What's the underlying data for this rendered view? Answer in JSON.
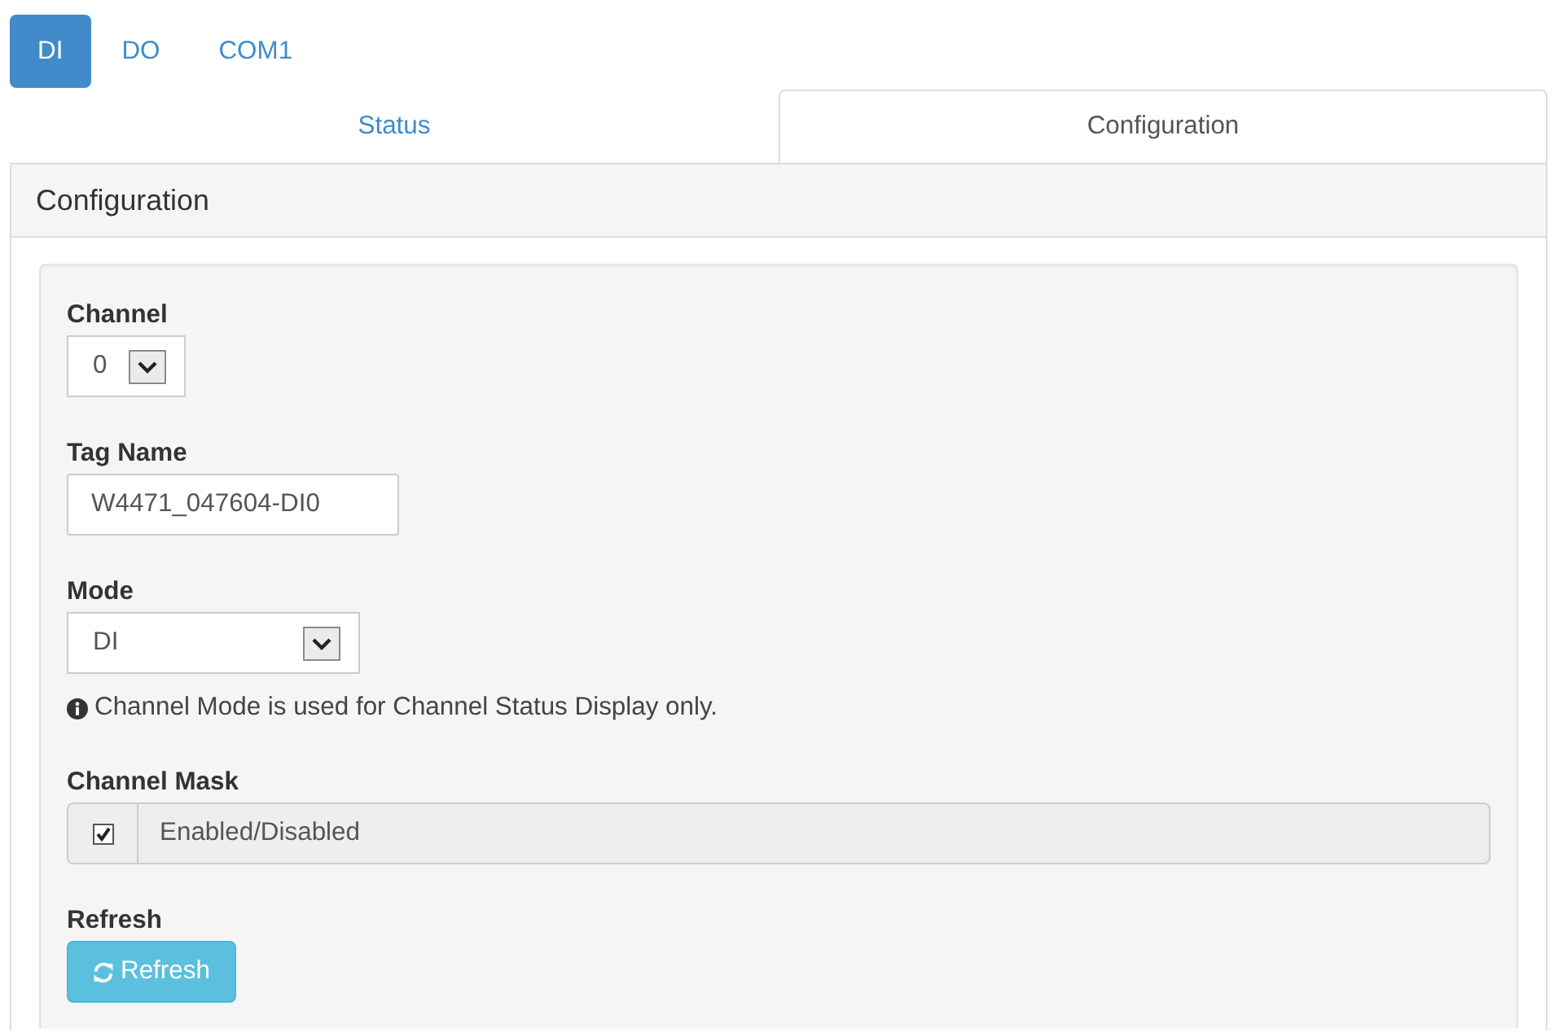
{
  "pills": [
    {
      "label": "DI",
      "selected": true
    },
    {
      "label": "DO",
      "selected": false
    },
    {
      "label": "COM1",
      "selected": false
    }
  ],
  "tabs": [
    {
      "label": "Status",
      "selected": false
    },
    {
      "label": "Configuration",
      "selected": true
    }
  ],
  "panel": {
    "title": "Configuration",
    "fields": [
      {
        "kind": "select",
        "label": "Channel",
        "value": "0"
      },
      {
        "kind": "text",
        "label": "Tag Name",
        "value": "W4471_047604-DI0"
      },
      {
        "kind": "select",
        "label": "Mode",
        "value": "DI",
        "help": "Channel Mode is used for Channel Status Display only."
      },
      {
        "kind": "checkbox",
        "label": "Channel Mask",
        "text": "Enabled/Disabled",
        "checked": true
      },
      {
        "kind": "button",
        "label": "Refresh",
        "button": "Refresh"
      }
    ]
  }
}
